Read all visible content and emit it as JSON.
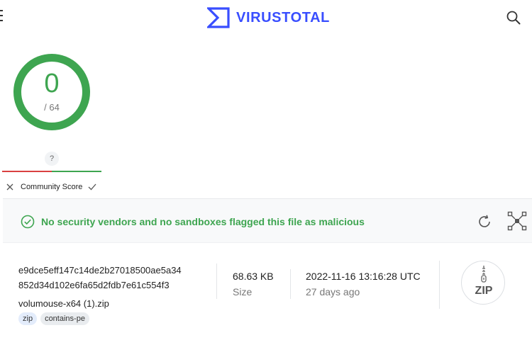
{
  "header": {
    "logo_text": "VIRUSTOTAL",
    "logo_icon": "virustotal-sigma-icon",
    "menu_icon": "hamburger-menu-icon",
    "search_icon": "search-icon"
  },
  "detection": {
    "score": "0",
    "total": "/ 64"
  },
  "community": {
    "help": "?",
    "label": "Community Score",
    "downvote_icon": "x-icon",
    "upvote_icon": "check-icon"
  },
  "banner": {
    "message": "No security vendors and no sandboxes flagged this file as malicious",
    "status_icon": "check-circle-icon",
    "reanalyze_icon": "reanalyze-icon",
    "graph_icon": "graph-icon"
  },
  "file": {
    "hash_line_1": "e9dce5eff147c14de2b27018500ae5a34",
    "hash_line_2": "852d34d102e6fa65d2fdb7e61c554f3",
    "name": "volumouse-x64 (1).zip",
    "tags": [
      "zip",
      "contains-pe"
    ],
    "size_value": "68.63 KB",
    "size_label": "Size",
    "date_value": "2022-11-16 13:16:28 UTC",
    "date_label": "27 days ago",
    "type_label": "ZIP",
    "type_icon": "zip-file-icon"
  },
  "colors": {
    "brand": "#394eff",
    "clean": "#3ea550",
    "malicious": "#d94040"
  }
}
